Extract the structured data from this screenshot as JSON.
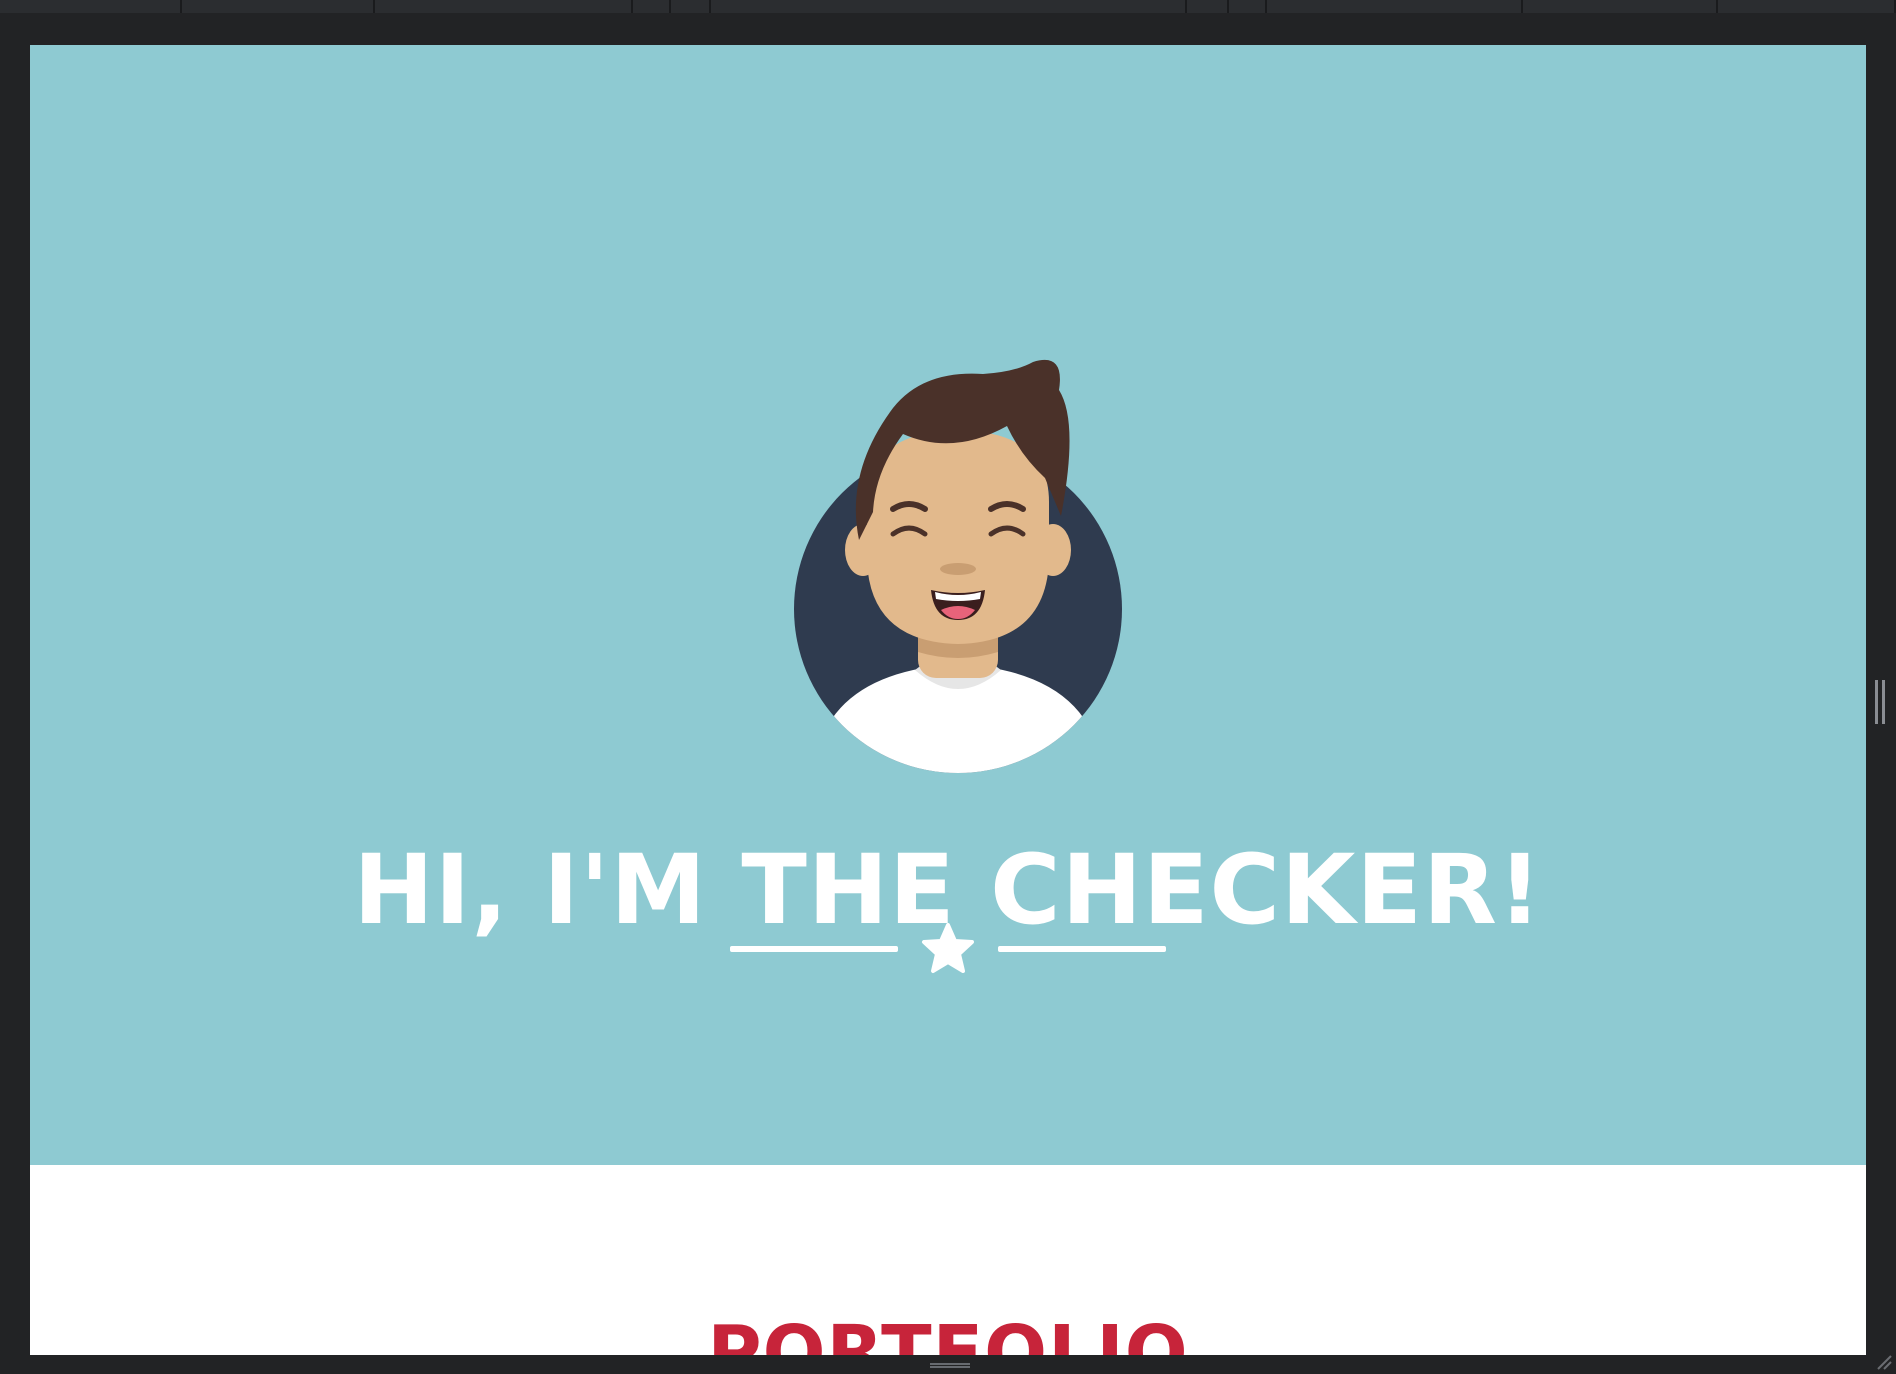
{
  "hero": {
    "title": "HI, I'M THE CHECKER!",
    "background_color": "#8ecad2",
    "divider_icon": "star-icon",
    "avatar_icon": "avatar-icon"
  },
  "portfolio": {
    "title": "PORTFOLIO",
    "title_color": "#c7243a"
  },
  "window": {
    "chrome_color": "#222325",
    "resize_handle_icon": "resize-grip-icon"
  }
}
